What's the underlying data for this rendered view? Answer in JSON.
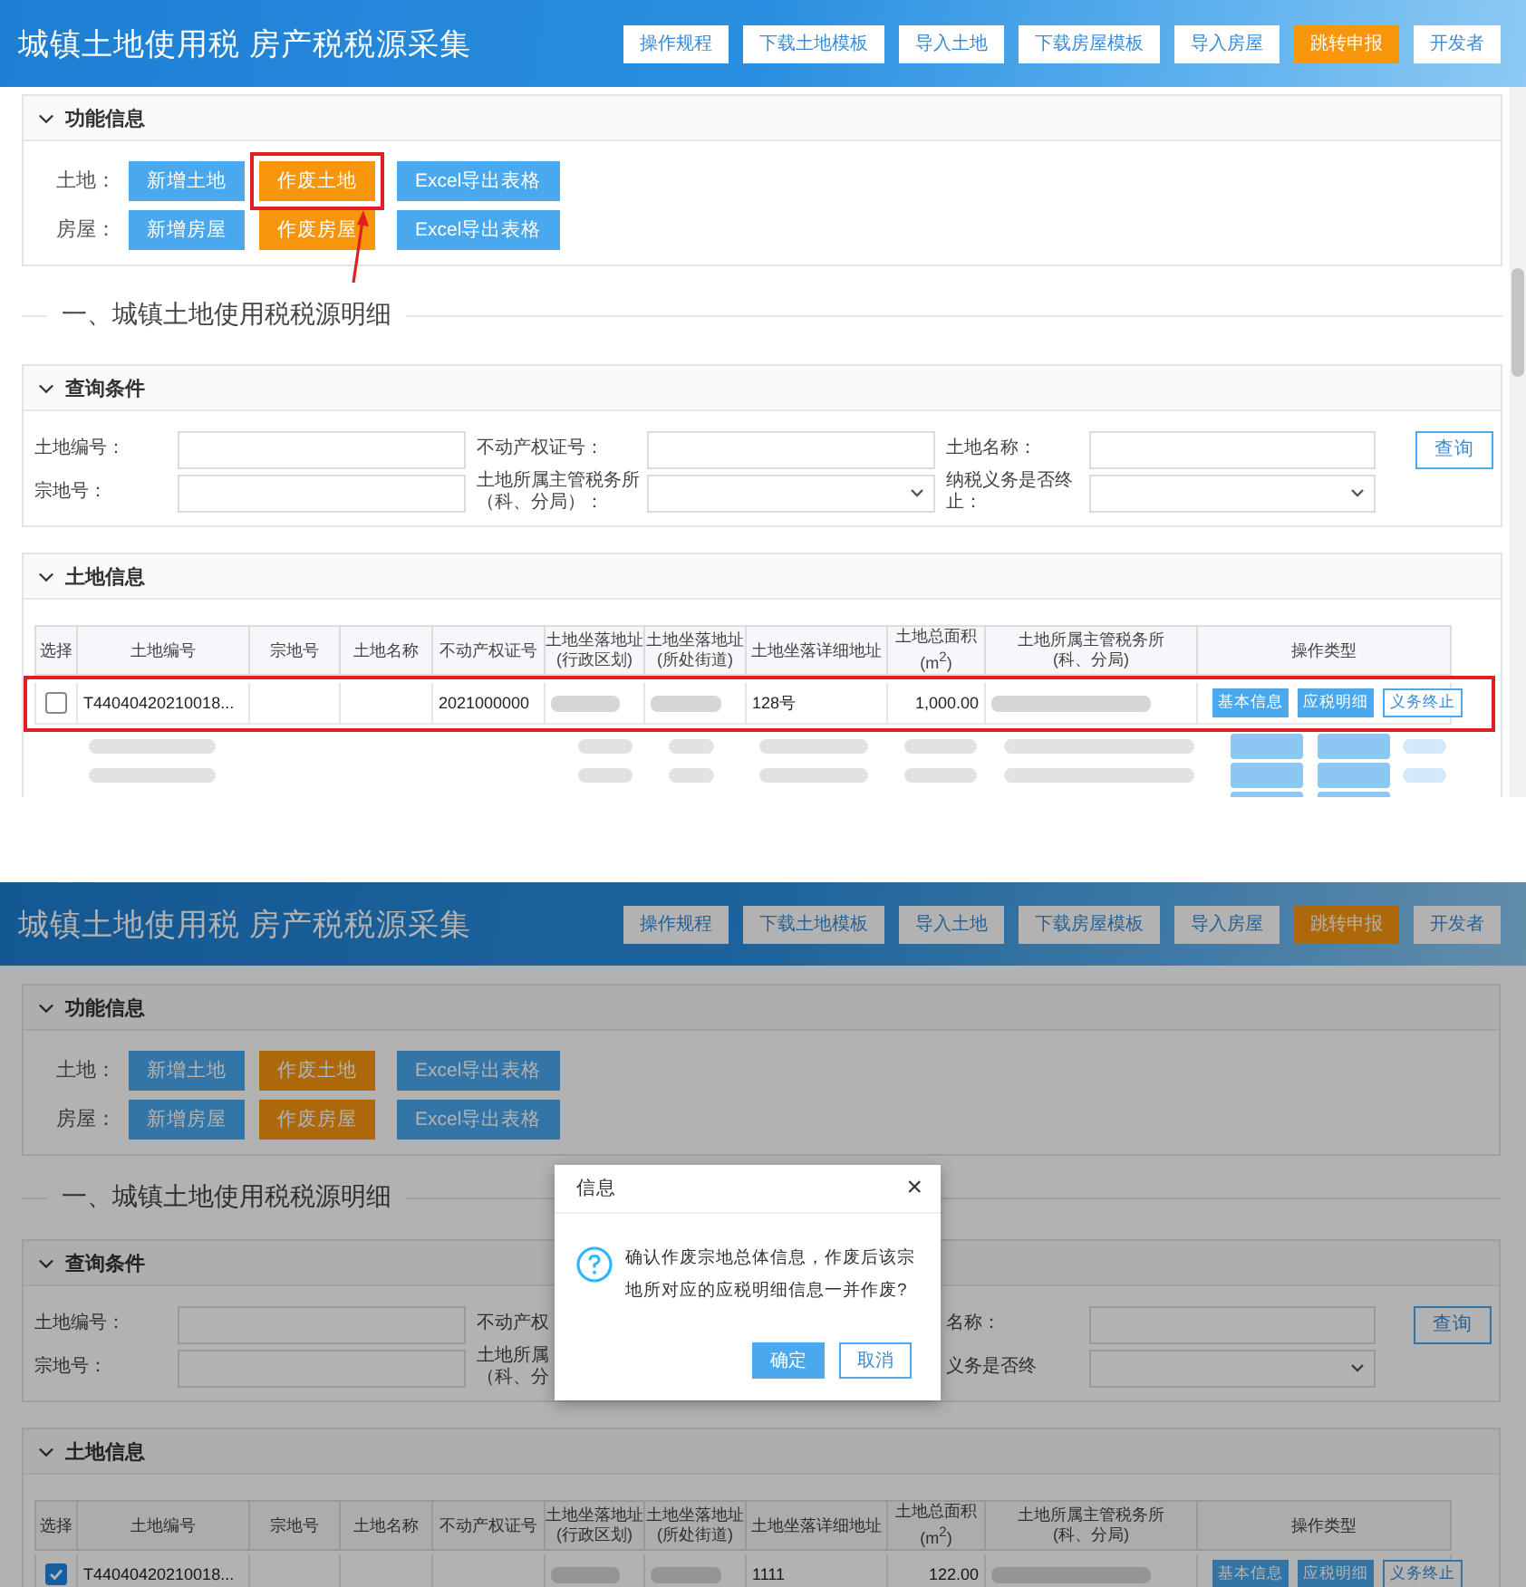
{
  "screens": [
    {
      "header": {
        "title": "城镇土地使用税 房产税税源采集",
        "buttons": [
          {
            "label": "操作规程",
            "kind": "plain"
          },
          {
            "label": "下载土地模板",
            "kind": "plain"
          },
          {
            "label": "导入土地",
            "kind": "plain"
          },
          {
            "label": "下载房屋模板",
            "kind": "plain"
          },
          {
            "label": "导入房屋",
            "kind": "plain"
          },
          {
            "label": "跳转申报",
            "kind": "accent"
          },
          {
            "label": "开发者",
            "kind": "plain"
          }
        ]
      },
      "function_panel": {
        "title": "功能信息",
        "rows": [
          {
            "label": "土地：",
            "buttons": [
              {
                "label": "新增土地",
                "kind": "primary"
              },
              {
                "label": "作废土地",
                "kind": "warning",
                "highlighted": true
              },
              {
                "label": "Excel导出表格",
                "kind": "primary"
              }
            ]
          },
          {
            "label": "房屋：",
            "buttons": [
              {
                "label": "新增房屋",
                "kind": "primary"
              },
              {
                "label": "作废房屋",
                "kind": "warning"
              },
              {
                "label": "Excel导出表格",
                "kind": "primary"
              }
            ]
          }
        ]
      },
      "section_title": "一、城镇土地使用税税源明细",
      "query_panel": {
        "title": "查询条件",
        "search_button": "查询",
        "fields": [
          {
            "label": "土地编号：",
            "kind": "input"
          },
          {
            "label": "不动产权证号：",
            "kind": "input"
          },
          {
            "label": "土地名称：",
            "kind": "input"
          },
          {
            "label": "宗地号：",
            "kind": "input"
          },
          {
            "label": "土地所属主管税务所（科、分局）：",
            "kind": "select"
          },
          {
            "label": "纳税义务是否终止：",
            "kind": "select"
          }
        ]
      },
      "land_panel": {
        "title": "土地信息",
        "columns": [
          "选择",
          "土地编号",
          "宗地号",
          "土地名称",
          "不动产权证号",
          "土地坐落地址\n(行政区划)",
          "土地坐落地址\n(所处街道)",
          "土地坐落详细地址",
          "土地总面积\n(m$^{2}$)",
          "土地所属主管税务所\n(科、分局)",
          "操作类型"
        ],
        "rows": [
          {
            "highlighted": true,
            "cells": [
              {
                "kind": "checkbox",
                "checked": false
              },
              {
                "kind": "text",
                "text": "T44040420210018..."
              },
              {
                "kind": "empty"
              },
              {
                "kind": "empty"
              },
              {
                "kind": "text",
                "text": "2021000000"
              },
              {
                "kind": "blurred"
              },
              {
                "kind": "blurred"
              },
              {
                "kind": "text",
                "text": "128号"
              },
              {
                "kind": "number",
                "text": "1,000.00"
              },
              {
                "kind": "blurred"
              },
              {
                "kind": "actions",
                "buttons": [
                  {
                    "label": "基本信息",
                    "kind": "primary"
                  },
                  {
                    "label": "应税明细",
                    "kind": "primary"
                  },
                  {
                    "label": "义务终止",
                    "kind": "outline"
                  }
                ]
              }
            ]
          }
        ],
        "blurred_rows": [
          {
            "kind": "blurred"
          },
          {
            "kind": "blurred"
          },
          {
            "kind": "blurred"
          }
        ]
      }
    },
    {
      "header": {
        "title": "城镇土地使用税 房产税税源采集",
        "buttons": [
          {
            "label": "操作规程",
            "kind": "plain"
          },
          {
            "label": "下载土地模板",
            "kind": "plain"
          },
          {
            "label": "导入土地",
            "kind": "plain"
          },
          {
            "label": "下载房屋模板",
            "kind": "plain"
          },
          {
            "label": "导入房屋",
            "kind": "plain"
          },
          {
            "label": "跳转申报",
            "kind": "accent"
          },
          {
            "label": "开发者",
            "kind": "plain"
          }
        ]
      },
      "function_panel": {
        "title": "功能信息",
        "rows": [
          {
            "label": "土地：",
            "buttons": [
              {
                "label": "新增土地",
                "kind": "primary"
              },
              {
                "label": "作废土地",
                "kind": "warning"
              },
              {
                "label": "Excel导出表格",
                "kind": "primary"
              }
            ]
          },
          {
            "label": "房屋：",
            "buttons": [
              {
                "label": "新增房屋",
                "kind": "primary"
              },
              {
                "label": "作废房屋",
                "kind": "warning"
              },
              {
                "label": "Excel导出表格",
                "kind": "primary"
              }
            ]
          }
        ]
      },
      "section_title": "一、城镇土地使用税税源明细",
      "query_panel": {
        "title": "查询条件",
        "search_button": "查询",
        "fields": [
          {
            "label": "土地编号：",
            "kind": "input"
          },
          {
            "label": "不动产权",
            "kind": "label"
          },
          {
            "label": "名称：",
            "kind": "input"
          },
          {
            "label": "宗地号：",
            "kind": "input"
          },
          {
            "label": "土地所属（科、分",
            "kind": "label"
          },
          {
            "label": "义务是否终",
            "kind": "select"
          }
        ]
      },
      "land_panel": {
        "title": "土地信息",
        "columns": [
          "选择",
          "土地编号",
          "宗地号",
          "土地名称",
          "不动产权证号",
          "土地坐落地址\n(行政区划)",
          "土地坐落地址\n(所处街道)",
          "土地坐落详细地址",
          "土地总面积\n(m$^{2}$)",
          "土地所属主管税务所\n(科、分局)",
          "操作类型"
        ],
        "rows": [
          {
            "cells": [
              {
                "kind": "checkbox",
                "checked": true
              },
              {
                "kind": "text",
                "text": "T44040420210018..."
              },
              {
                "kind": "empty"
              },
              {
                "kind": "empty"
              },
              {
                "kind": "empty"
              },
              {
                "kind": "blurred"
              },
              {
                "kind": "blurred"
              },
              {
                "kind": "text",
                "text": "1111"
              },
              {
                "kind": "number",
                "text": "122.00"
              },
              {
                "kind": "blurred"
              },
              {
                "kind": "actions",
                "buttons": [
                  {
                    "label": "基本信息",
                    "kind": "primary"
                  },
                  {
                    "label": "应税明细",
                    "kind": "primary"
                  },
                  {
                    "label": "义务终止",
                    "kind": "outline"
                  }
                ]
              }
            ]
          }
        ]
      },
      "dialog": {
        "title": "信息",
        "close": "×",
        "message": "确认作废宗地总体信息，作废后该宗地所对应的应税明细信息一并作废?",
        "buttons": [
          {
            "label": "确定",
            "kind": "primary"
          },
          {
            "label": "取消",
            "kind": "outline"
          }
        ]
      }
    }
  ]
}
